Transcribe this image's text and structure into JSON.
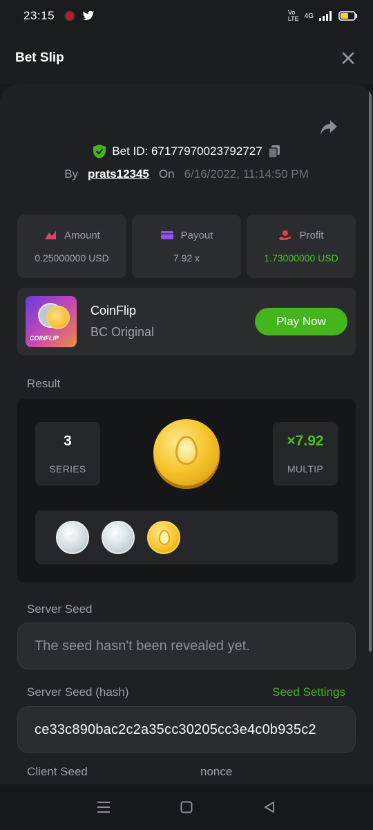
{
  "status_bar": {
    "time": "23:15",
    "network": "4G"
  },
  "header": {
    "title": "Bet Slip"
  },
  "bet": {
    "id_label": "Bet ID: 67177970023792727",
    "by_label": "By",
    "username": "prats12345",
    "on_label": "On",
    "date": "6/16/2022, 11:14:50 PM"
  },
  "stats": [
    {
      "label": "Amount",
      "value": "0.25000000 USD",
      "icon": "amount-icon",
      "color": "#e0436b"
    },
    {
      "label": "Payout",
      "value": "7.92 x",
      "icon": "card-icon",
      "color": "#8f55e8"
    },
    {
      "label": "Profit",
      "value": "1.73000000 USD",
      "icon": "profit-icon",
      "color": "#e2413a"
    }
  ],
  "game": {
    "name": "CoinFlip",
    "category": "BC Original",
    "thumb_label": "COINFLIP",
    "play_label": "Play Now"
  },
  "result": {
    "section_label": "Result",
    "series_value": "3",
    "series_label": "SERIES",
    "multiplier_value": "×7.92",
    "multiplier_label": "MULTIP",
    "coins": [
      "silver",
      "silver",
      "gold"
    ]
  },
  "server_seed": {
    "label": "Server Seed",
    "placeholder": "The seed hasn't been revealed yet."
  },
  "server_seed_hash": {
    "label": "Server Seed (hash)",
    "settings_link": "Seed Settings",
    "value": "ce33c890bac2c2a35cc30205cc3e4c0b935c2"
  },
  "client_seed": {
    "label": "Client Seed",
    "nonce_label": "nonce"
  },
  "colors": {
    "accent_green": "#44b51c",
    "profit_green": "#4fc21a",
    "background": "#1f2023"
  }
}
